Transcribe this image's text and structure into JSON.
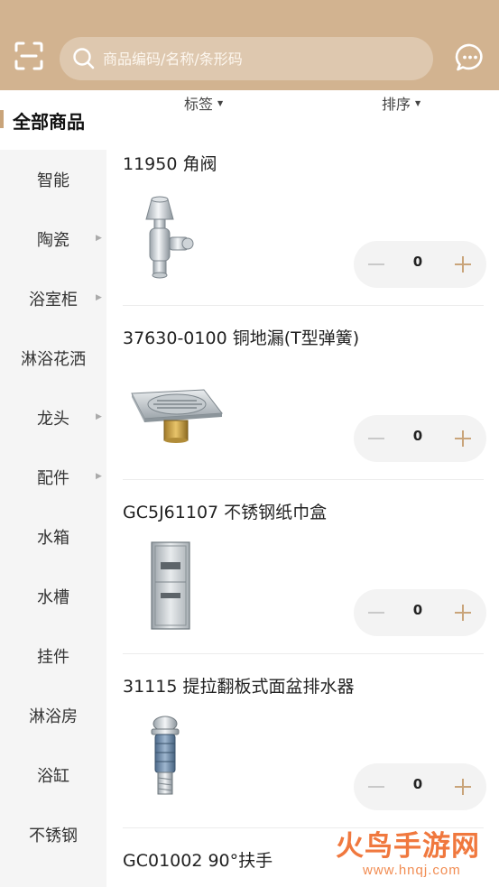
{
  "header": {
    "search_placeholder": "商品编码/名称/条形码"
  },
  "icons": {
    "scan": "scan-icon",
    "search": "search-icon",
    "message": "chat-icon"
  },
  "colors": {
    "header_bg": "#d2b390",
    "accent": "#c9a47a",
    "sidebar_bg": "#f5f5f5",
    "stepper_bg": "#f3f3f3"
  },
  "filters": {
    "tag": "标签",
    "sort": "排序"
  },
  "sidebar": {
    "all_label": "全部商品",
    "items": [
      {
        "label": "智能",
        "has_sub": false
      },
      {
        "label": "陶瓷",
        "has_sub": true
      },
      {
        "label": "浴室柜",
        "has_sub": true
      },
      {
        "label": "淋浴花洒",
        "has_sub": false
      },
      {
        "label": "龙头",
        "has_sub": true
      },
      {
        "label": "配件",
        "has_sub": true
      },
      {
        "label": "水箱",
        "has_sub": false
      },
      {
        "label": "水槽",
        "has_sub": false
      },
      {
        "label": "挂件",
        "has_sub": false
      },
      {
        "label": "淋浴房",
        "has_sub": false
      },
      {
        "label": "浴缸",
        "has_sub": false
      },
      {
        "label": "不锈钢",
        "has_sub": false
      }
    ]
  },
  "products": [
    {
      "title": "11950 角阀",
      "qty": "0",
      "image": "angle-valve-image"
    },
    {
      "title": "37630-0100 铜地漏(T型弹簧)",
      "qty": "0",
      "image": "floor-drain-image"
    },
    {
      "title": "GC5J61107 不锈钢纸巾盒",
      "qty": "0",
      "image": "paper-towel-box-image"
    },
    {
      "title": "31115 提拉翻板式面盆排水器",
      "qty": "0",
      "image": "basin-drain-image"
    },
    {
      "title": "GC01002 90°扶手",
      "qty": "",
      "image": ""
    }
  ],
  "watermark": {
    "brand": "火鸟手游网",
    "url": "www.hnqj.com"
  }
}
